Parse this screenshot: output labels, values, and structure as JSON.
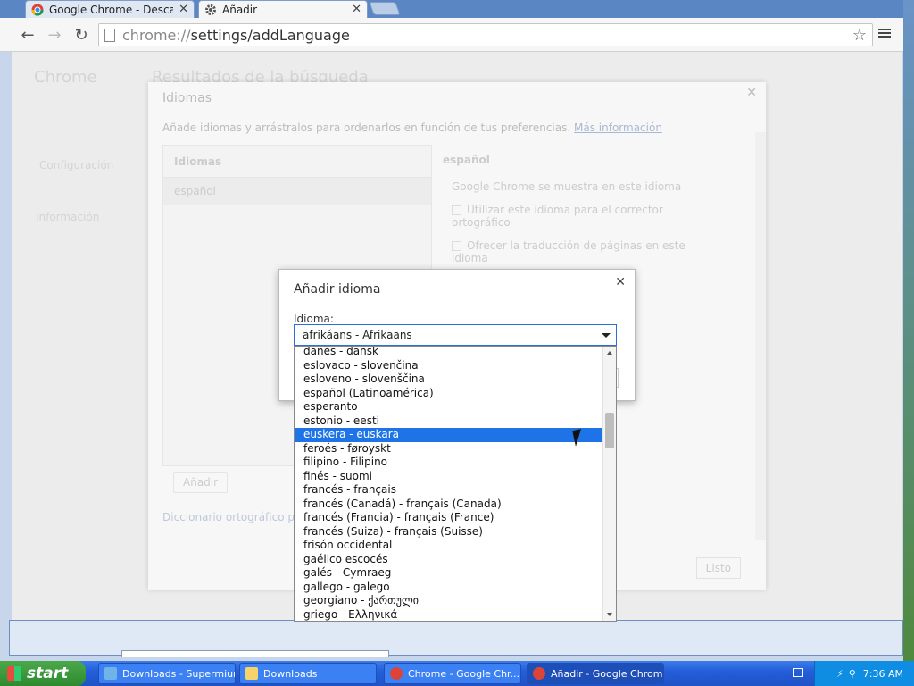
{
  "browser": {
    "tabs": [
      {
        "title": "Google Chrome - Descarga e",
        "icon": "chrome-icon"
      },
      {
        "title": "Añadir",
        "icon": "gear-icon"
      }
    ],
    "url_scheme": "chrome://",
    "url_rest": "settings/addLanguage"
  },
  "background_settings": {
    "brand": "Chrome",
    "page_heading": "Resultados de la búsqueda",
    "left_item_2": "Configuración",
    "left_item_3": "Información"
  },
  "languages_overlay": {
    "title": "Idiomas",
    "description": "Añade idiomas y arrástralos para ordenarlos en función de tus preferencias.",
    "more_info_link": "Más información",
    "list_header": "Idiomas",
    "list_items": [
      "español"
    ],
    "detail_header": "español",
    "detail_line_1": "Google Chrome se muestra en este idioma",
    "detail_line_2": "Utilizar este idioma para el corrector ortográfico",
    "detail_line_3": "Ofrecer la traducción de páginas en este idioma",
    "add_button": "Añadir",
    "dictionary_link": "Diccionario ortográfico pers",
    "done_button": "Listo"
  },
  "add_language_dialog": {
    "title": "Añadir idioma",
    "field_label": "Idioma:",
    "selected_value": "afrikáans - Afrikaans",
    "options": [
      "danés - dansk",
      "eslovaco - slovenčina",
      "esloveno - slovenščina",
      "español (Latinoamérica)",
      "esperanto",
      "estonio - eesti",
      "euskera - euskara",
      "feroés - føroyskt",
      "filipino - Filipino",
      "finés - suomi",
      "francés - français",
      "francés (Canadá) - français (Canada)",
      "francés (Francia) - français (France)",
      "francés (Suiza) - français (Suisse)",
      "frisón occidental",
      "gaélico escocés",
      "galés - Cymraeg",
      "gallego - galego",
      "georgiano - ქართული",
      "griego - Ελληνικά"
    ],
    "highlighted_option": "euskera - euskara"
  },
  "taskbar": {
    "start_label": "start",
    "tasks": [
      "Downloads - Supermium",
      "Downloads",
      "Chrome - Google Chr...",
      "Añadir - Google Chrome"
    ],
    "clock": "7:36 AM"
  }
}
